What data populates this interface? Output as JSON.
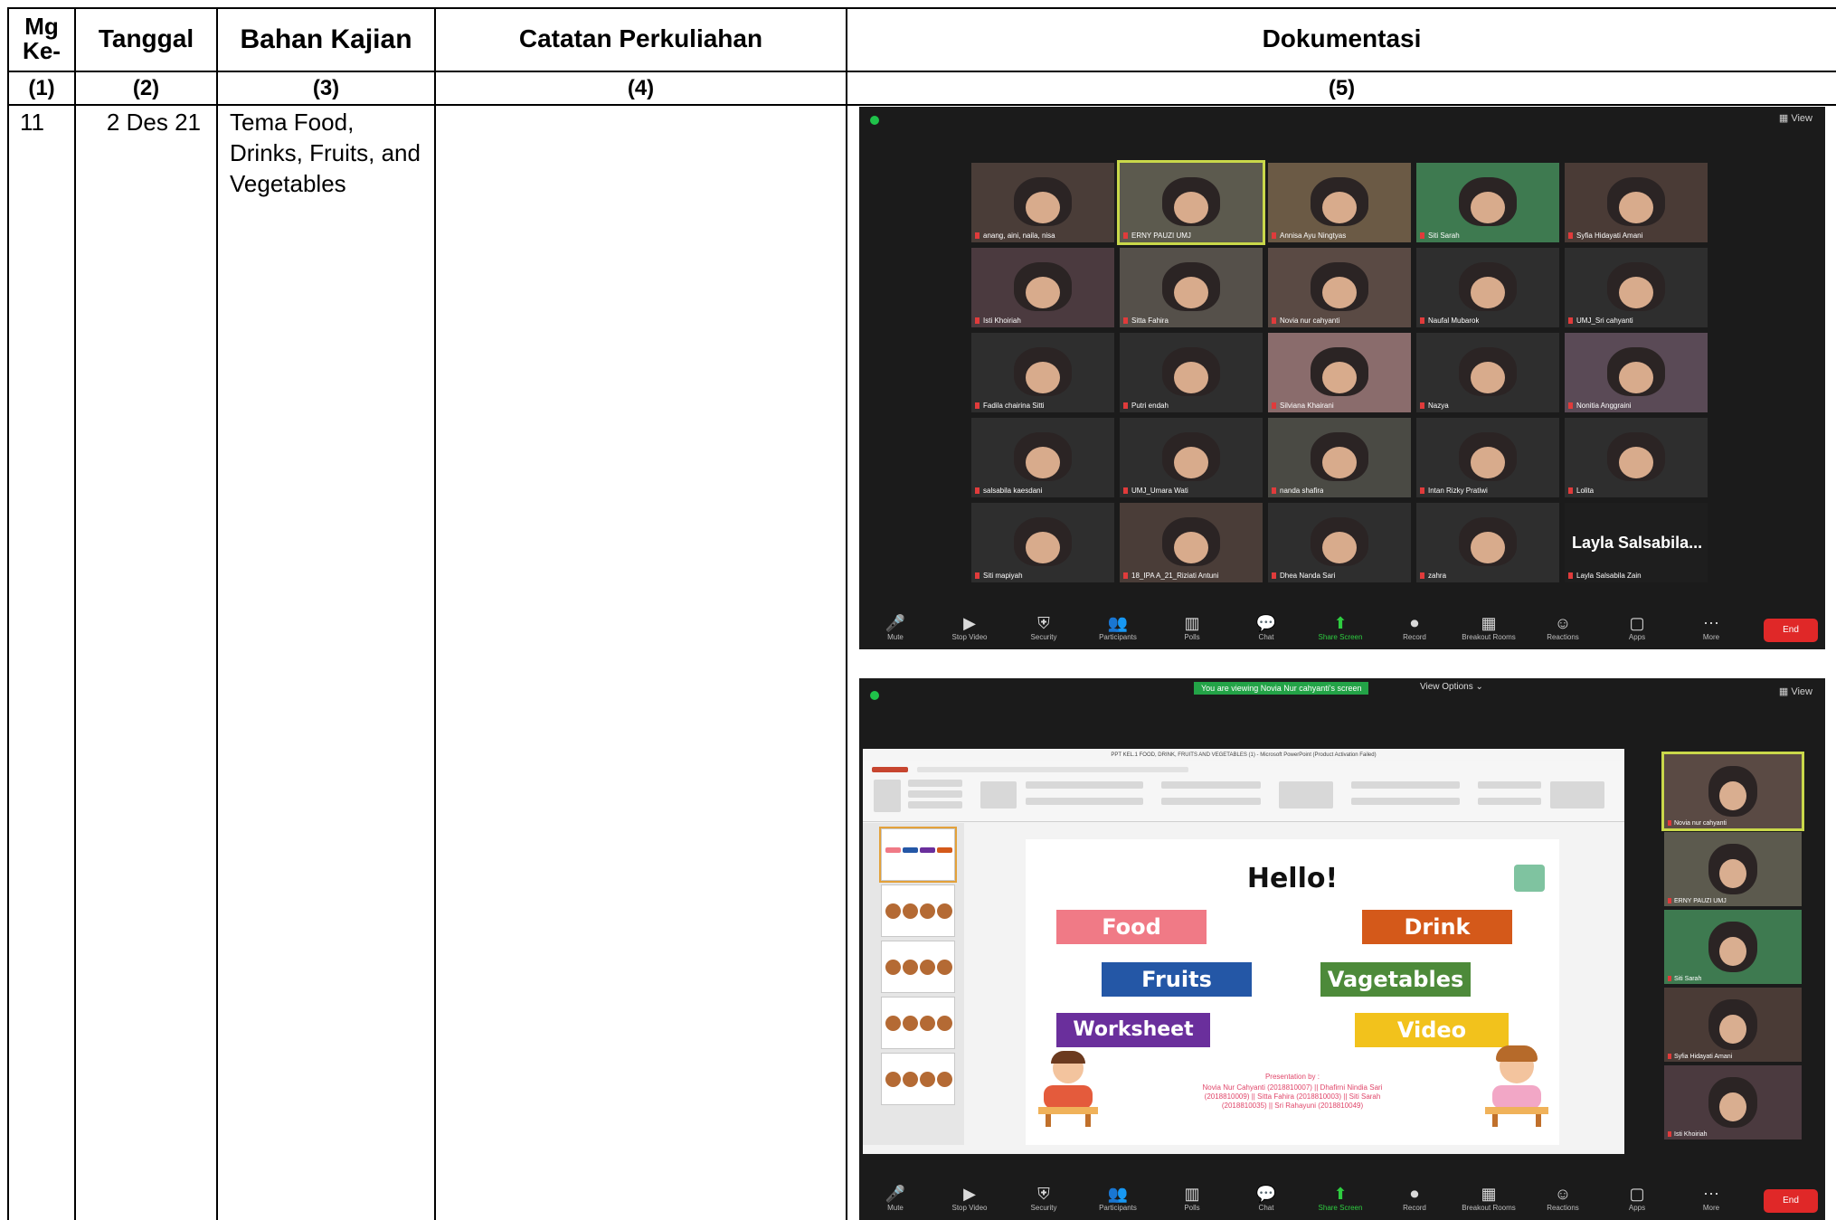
{
  "table": {
    "headers": [
      "Mg\nKe-",
      "Tanggal",
      "Bahan Kajian",
      "Catatan Perkuliahan",
      "Dokumentasi"
    ],
    "numbers": [
      "(1)",
      "(2)",
      "(3)",
      "(4)",
      "(5)"
    ],
    "row": {
      "week": "11",
      "date": "2 Des 21",
      "topic": "Tema Food, Drinks, Fruits, and Vegetables",
      "notes": ""
    }
  },
  "zoom1": {
    "view_label": "View",
    "participants": [
      "anang, aini, naila, nisa",
      "ERNY PAUZI UMJ",
      "Annisa Ayu Ningtyas",
      "Siti Sarah",
      "Syfia Hidayati Amani",
      "Isti Khoiriah",
      "Sitta Fahira",
      "Novia nur cahyanti",
      "Naufal Mubarok",
      "UMJ_Sri cahyanti",
      "Fadila chairina Sitti",
      "Putri endah",
      "Silviana Khairani",
      "Nazya",
      "Nonitia Anggraini",
      "salsabila kaesdani",
      "UMJ_Umara Wati",
      "nanda shafira",
      "Intan Rizky Pratiwi",
      "Lolita",
      "Siti mapiyah",
      "18_IPA A_21_Riziati Antuni",
      "Dhea Nanda Sari",
      "zahra",
      "Layla Salsabila Zain"
    ],
    "big_name": "Layla Salsabila...",
    "toolbar": [
      "Mute",
      "Stop Video",
      "Security",
      "Participants",
      "Polls",
      "Chat",
      "Share Screen",
      "Record",
      "Breakout Rooms",
      "Reactions",
      "Apps",
      "More"
    ],
    "end_label": "End"
  },
  "zoom2": {
    "banner": "You are viewing Novia Nur cahyanti's screen",
    "view_options": "View Options ⌄",
    "view_label": "View",
    "ppt_title": "PPT KEL.1 FOOD, DRINK, FRUITS AND VEGETABLES (1) - Microsoft PowerPoint (Product Activation Failed)",
    "slide": {
      "title": "Hello!",
      "buttons": [
        {
          "label": "Food",
          "color": "#f07a86"
        },
        {
          "label": "Drink",
          "color": "#d4591a"
        },
        {
          "label": "Fruits",
          "color": "#2457a6"
        },
        {
          "label": "Vagetables",
          "color": "#4d8a3a"
        },
        {
          "label": "Worksheet",
          "color": "#6a2f9c"
        },
        {
          "label": "Video",
          "color": "#f2c21c"
        }
      ],
      "presentation_by": "Presentation by :",
      "members_1": "Novia Nur Cahyanti (2018810007) || Dhafirni Nindia Sari",
      "members_2": "(2018810009) || Sitta Fahira (2018810003) || Siti Sarah",
      "members_3": "(2018810035) || Sri Rahayuni (2018810049)"
    },
    "side_participants": [
      "Novia nur cahyanti",
      "ERNY PAUZI UMJ",
      "Siti Sarah",
      "Syfia Hidayati Amani",
      "Isti Khoiriah"
    ],
    "toolbar": [
      "Mute",
      "Stop Video",
      "Security",
      "Participants",
      "Polls",
      "Chat",
      "Share Screen",
      "Record",
      "Breakout Rooms",
      "Reactions",
      "Apps",
      "More"
    ],
    "end_label": "End"
  },
  "colors": {
    "zoom_bg": "#1b1b1b",
    "share_green": "#2ecc40",
    "end_red": "#e02828",
    "speaker_outline": "#c9d84a"
  }
}
